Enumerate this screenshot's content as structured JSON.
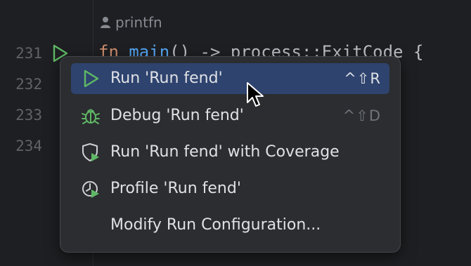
{
  "editor": {
    "author_hint": "printfn",
    "line_numbers": [
      "231",
      "232",
      "233",
      "234"
    ],
    "code": {
      "keyword": "fn",
      "function_name": "main",
      "rest": "() -> process::ExitCode {"
    }
  },
  "context_menu": {
    "items": [
      {
        "label": "Run 'Run fend'",
        "shortcut": "^⇧R",
        "icon": "run-icon",
        "selected": true
      },
      {
        "label": "Debug 'Run fend'",
        "shortcut": "^⇧D",
        "icon": "debug-icon",
        "selected": false
      },
      {
        "label": "Run 'Run fend' with Coverage",
        "shortcut": "",
        "icon": "coverage-icon",
        "selected": false
      },
      {
        "label": "Profile 'Run fend'",
        "shortcut": "",
        "icon": "profile-icon",
        "selected": false
      },
      {
        "label": "Modify Run Configuration...",
        "shortcut": "",
        "icon": "",
        "selected": false
      }
    ]
  },
  "colors": {
    "accent_green": "#5fb865",
    "selection_blue": "#2e436e",
    "popup_bg": "#2b2d30"
  }
}
